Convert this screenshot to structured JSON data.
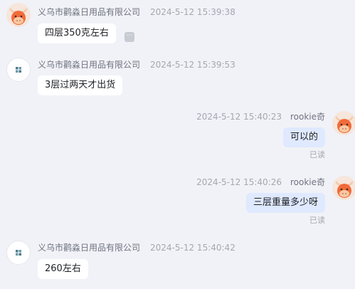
{
  "messages": [
    {
      "sender": "义乌市鹳淼日用品有限公司",
      "time": "2024-5-12 15:39:38",
      "text": "四层350克左右",
      "avatar_icon": "ox-avatar",
      "more_icon": "ellipsis-icon",
      "more_glyph": "···"
    },
    {
      "sender": "义乌市鹳淼日用品有限公司",
      "time": "2024-5-12 15:39:53",
      "text": "3层过两天才出货",
      "avatar_icon": "company-logo-avatar"
    },
    {
      "sender": "rookie奇",
      "time": "2024-5-12 15:40:23",
      "text": "可以的",
      "status": "已读",
      "avatar_icon": "ox-avatar"
    },
    {
      "sender": "rookie奇",
      "time": "2024-5-12 15:40:26",
      "text": "三层重量多少呀",
      "status": "已读",
      "avatar_icon": "ox-avatar"
    },
    {
      "sender": "义乌市鹳淼日用品有限公司",
      "time": "2024-5-12 15:40:42",
      "text": "260左右",
      "avatar_icon": "company-logo-avatar"
    }
  ],
  "colors": {
    "background": "#f1f2f7",
    "incoming_bubble": "#ffffff",
    "outgoing_bubble": "#dfe9ff",
    "avatar_orange": "#f26b3a"
  }
}
